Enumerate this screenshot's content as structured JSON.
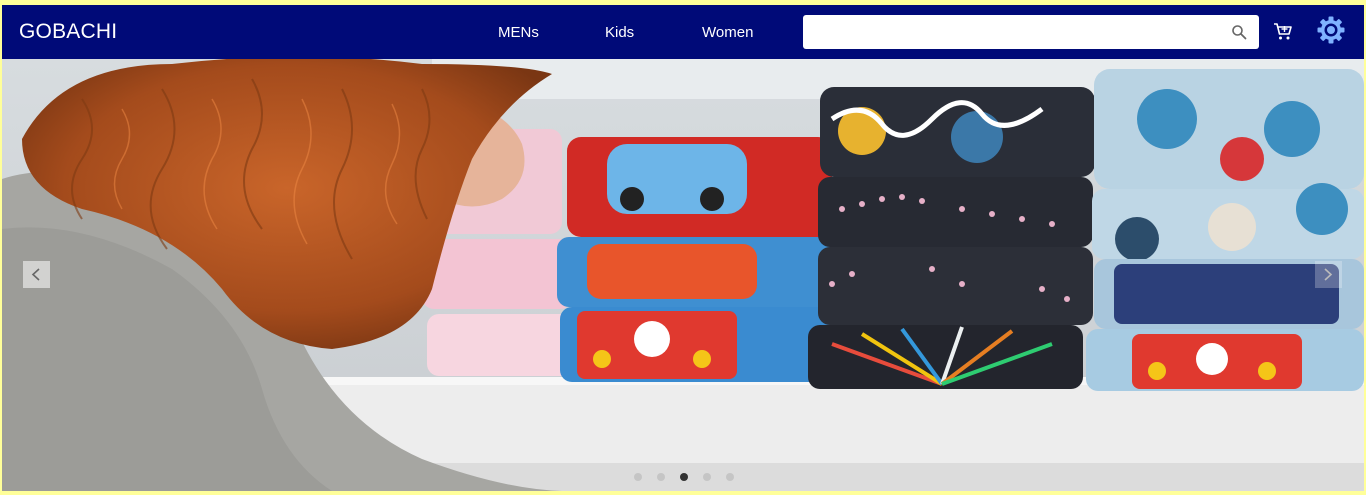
{
  "navbar": {
    "brand": "GOBACHI",
    "links": [
      {
        "label": "MENs"
      },
      {
        "label": "Kids"
      },
      {
        "label": "Women"
      }
    ],
    "search": {
      "value": "",
      "placeholder": ""
    },
    "icons": [
      "search-icon",
      "cart-icon",
      "gear-icon"
    ],
    "background_color": "#000a78"
  },
  "carousel": {
    "slide_count": 5,
    "active_index": 2,
    "controls": [
      "chevron-left-icon",
      "chevron-right-icon"
    ]
  }
}
